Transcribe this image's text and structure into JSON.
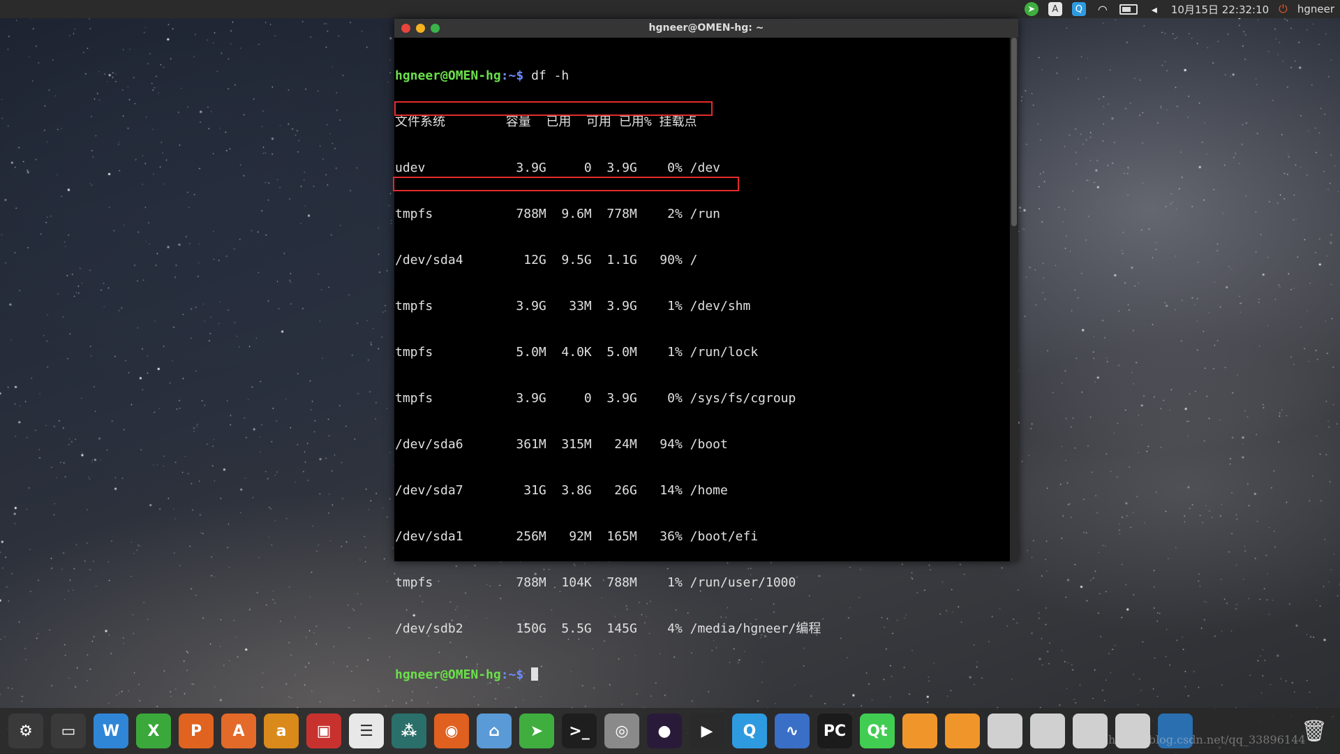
{
  "top_panel": {
    "clock": "10月15日 22:32:10",
    "user": "hgneer",
    "tray_icons": [
      "telegram-icon",
      "input-method-icon",
      "qq-icon",
      "wifi-icon",
      "battery-icon",
      "volume-icon"
    ]
  },
  "terminal": {
    "title": "hgneer@OMEN-hg: ~",
    "prompt_user": "hgneer@OMEN-hg",
    "prompt_sep": ":~$",
    "command": " df -h",
    "header": "文件系统        容量  已用  可用 已用% 挂载点",
    "rows": [
      "udev            3.9G     0  3.9G    0% /dev",
      "tmpfs           788M  9.6M  778M    2% /run",
      "/dev/sda4        12G  9.5G  1.1G   90% /",
      "tmpfs           3.9G   33M  3.9G    1% /dev/shm",
      "tmpfs           5.0M  4.0K  5.0M    1% /run/lock",
      "tmpfs           3.9G     0  3.9G    0% /sys/fs/cgroup",
      "/dev/sda6       361M  315M   24M   94% /boot",
      "/dev/sda7        31G  3.8G   26G   14% /home",
      "/dev/sda1       256M   92M  165M   36% /boot/efi",
      "tmpfs           788M  104K  788M    1% /run/user/1000",
      "/dev/sdb2       150G  5.5G  145G    4% /media/hgneer/编程"
    ]
  },
  "dock": {
    "icons": [
      {
        "name": "system-settings-icon",
        "glyph": "⚙",
        "color": "#3a3a3a"
      },
      {
        "name": "workspace-switcher-icon",
        "glyph": "▭",
        "color": "#3a3a3a"
      },
      {
        "name": "writer-icon",
        "glyph": "W",
        "color": "#2f86d6"
      },
      {
        "name": "spreadsheet-icon",
        "glyph": "X",
        "color": "#3aa83a"
      },
      {
        "name": "presentation-icon",
        "glyph": "P",
        "color": "#e0631f"
      },
      {
        "name": "software-center-icon",
        "glyph": "A",
        "color": "#e46a2a"
      },
      {
        "name": "amazon-icon",
        "glyph": "a",
        "color": "#d98a1a"
      },
      {
        "name": "toolbox-icon",
        "glyph": "▣",
        "color": "#c8322e"
      },
      {
        "name": "equalizer-icon",
        "glyph": "☰",
        "color": "#e8e8e8"
      },
      {
        "name": "network-tool-icon",
        "glyph": "⁂",
        "color": "#2a6f6a"
      },
      {
        "name": "firefox-icon",
        "glyph": "◉",
        "color": "#e0601f"
      },
      {
        "name": "files-icon",
        "glyph": "⌂",
        "color": "#5a9ad6"
      },
      {
        "name": "telegram-icon",
        "glyph": "➤",
        "color": "#3fae3f"
      },
      {
        "name": "terminal-icon",
        "glyph": ">_",
        "color": "#1e1e1e"
      },
      {
        "name": "chrome-icon",
        "glyph": "◎",
        "color": "#8a8a8a"
      },
      {
        "name": "eclipse-icon",
        "glyph": "●",
        "color": "#2a1a3a"
      },
      {
        "name": "media-player-icon",
        "glyph": "▶",
        "color": "#2a2a2a"
      },
      {
        "name": "qq-icon",
        "glyph": "Q",
        "color": "#2e9be0"
      },
      {
        "name": "wireshark-icon",
        "glyph": "∿",
        "color": "#3a6fc8"
      },
      {
        "name": "pycharm-icon",
        "glyph": "PC",
        "color": "#1b1b1b"
      },
      {
        "name": "qt-creator-icon",
        "glyph": "Qt",
        "color": "#41cd52"
      },
      {
        "name": "orange-window-1-icon",
        "glyph": "",
        "color": "#f0952a"
      },
      {
        "name": "orange-window-2-icon",
        "glyph": "",
        "color": "#f0952a"
      },
      {
        "name": "blank-window-1-icon",
        "glyph": "",
        "color": "#d0d0d0"
      },
      {
        "name": "blank-window-2-icon",
        "glyph": "",
        "color": "#d0d0d0"
      },
      {
        "name": "blank-window-3-icon",
        "glyph": "",
        "color": "#d0d0d0"
      },
      {
        "name": "blank-window-4-icon",
        "glyph": "",
        "color": "#d0d0d0"
      },
      {
        "name": "blue-window-icon",
        "glyph": "",
        "color": "#2a6fb0"
      }
    ],
    "trash_glyph": "🗑"
  },
  "watermark": "https://blog.csdn.net/qq_33896144"
}
